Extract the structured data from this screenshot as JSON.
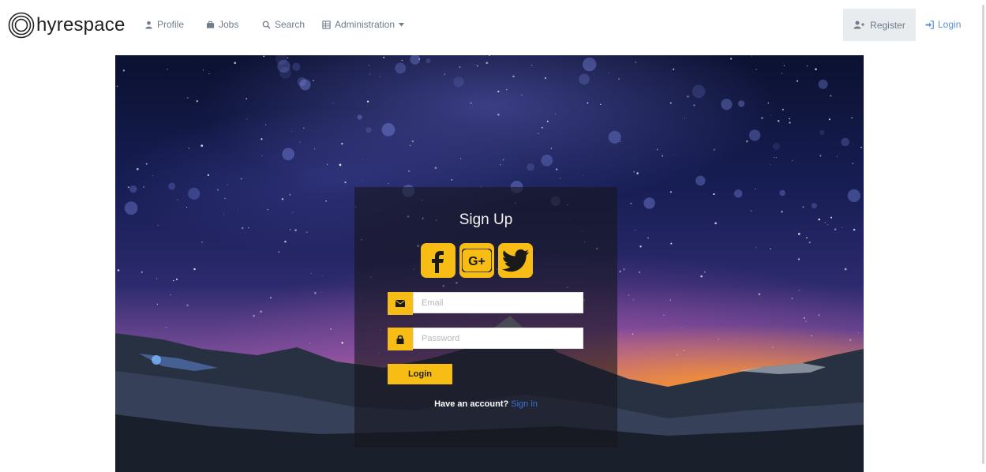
{
  "brand": {
    "name": "hyrespace",
    "logo_icon": "concentric-circles-logo"
  },
  "nav": {
    "items": [
      {
        "label": "Profile",
        "icon": "user-icon"
      },
      {
        "label": "Jobs",
        "icon": "briefcase-icon"
      },
      {
        "label": "Search",
        "icon": "search-icon"
      },
      {
        "label": "Administration",
        "icon": "table-icon",
        "dropdown": true
      }
    ],
    "register": {
      "label": "Register",
      "icon": "user-plus-icon"
    },
    "login": {
      "label": "Login",
      "icon": "sign-in-icon"
    }
  },
  "signup": {
    "title": "Sign Up",
    "social": [
      {
        "name": "facebook",
        "icon": "facebook-icon"
      },
      {
        "name": "google-plus",
        "icon": "google-plus-icon",
        "text": "G+"
      },
      {
        "name": "twitter",
        "icon": "twitter-icon"
      }
    ],
    "email": {
      "placeholder": "Email",
      "value": "",
      "icon": "envelope-icon"
    },
    "password": {
      "placeholder": "Password",
      "value": "",
      "icon": "lock-icon"
    },
    "submit_label": "Login",
    "have_account_text": "Have an account?",
    "signin_link": "Sign in"
  },
  "colors": {
    "accent": "#f7bd14",
    "nav_text": "#6f7c8a",
    "link": "#3b6fd8",
    "register_bg": "#e9ecef"
  }
}
